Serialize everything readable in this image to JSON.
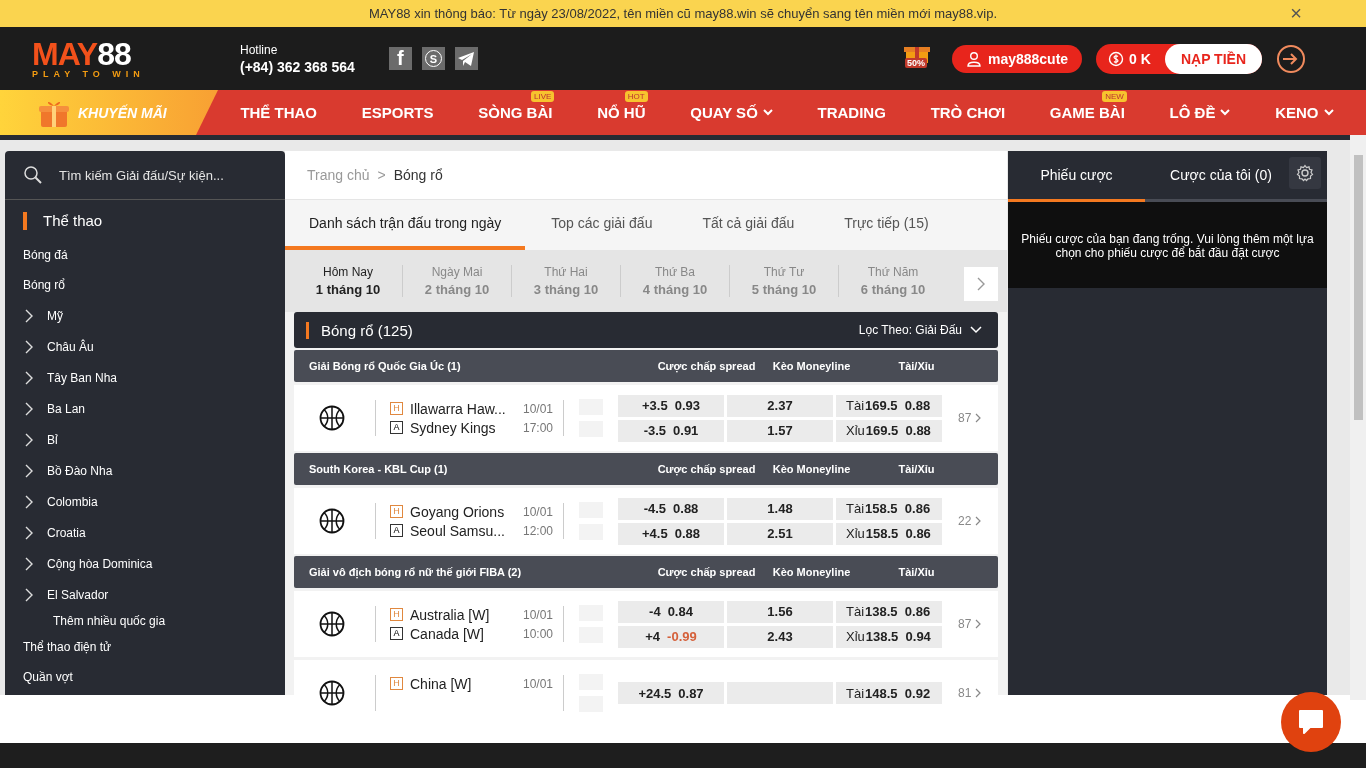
{
  "notice": {
    "text": "MAY88 xin thông báo: Từ ngày 23/08/2022, tên miền cũ may88.win sẽ chuyển sang tên miền mới may88.vip.",
    "close": "×"
  },
  "header": {
    "logo": {
      "brand_a": "MAY",
      "brand_b": "88",
      "tagline": "PLAY TO WIN"
    },
    "hotline_label": "Hotline",
    "hotline": "(+84) 362 368 564",
    "social": [
      {
        "kind": "facebook",
        "glyph": "f"
      },
      {
        "kind": "skype",
        "glyph": "S"
      },
      {
        "kind": "telegram"
      }
    ],
    "promo_badge": "50%",
    "username": "may888cute",
    "balance": "0 K",
    "deposit": "NẠP TIỀN"
  },
  "nav": {
    "promo": "KHUYẾN MÃI",
    "items": [
      {
        "label": "THỂ THAO",
        "dropdown": false
      },
      {
        "label": "ESPORTS",
        "dropdown": false
      },
      {
        "label": "SÒNG BÀI",
        "badge": "LIVE",
        "dropdown": false
      },
      {
        "label": "NỔ HŨ",
        "badge": "HOT",
        "dropdown": false
      },
      {
        "label": "QUAY SỐ",
        "dropdown": true
      },
      {
        "label": "TRADING",
        "dropdown": false
      },
      {
        "label": "TRÒ CHƠI",
        "dropdown": false
      },
      {
        "label": "GAME BÀI",
        "badge": "NEW",
        "dropdown": false
      },
      {
        "label": "LÔ ĐỀ",
        "dropdown": true
      },
      {
        "label": "KENO",
        "dropdown": true
      }
    ]
  },
  "sidebar": {
    "search": {
      "placeholder": "Tìm kiếm Giải đấu/Sự kiện..."
    },
    "title": "Thể thao",
    "items": [
      {
        "label": "Bóng đá"
      },
      {
        "label": "Bóng rổ",
        "children": [
          {
            "label": "Mỹ",
            "expanded": false
          },
          {
            "label": "Châu Âu",
            "expanded": false
          },
          {
            "label": "Tây Ban Nha",
            "expanded": false
          },
          {
            "label": "Ba Lan",
            "expanded": false
          },
          {
            "label": "Bỉ",
            "expanded": false
          },
          {
            "label": "Bồ Đào Nha",
            "expanded": false
          },
          {
            "label": "Colombia",
            "expanded": false
          },
          {
            "label": "Croatia",
            "expanded": false
          },
          {
            "label": "Cộng hòa Dominica",
            "expanded": false
          },
          {
            "label": "El Salvador",
            "expanded": false
          }
        ],
        "more": "Thêm nhiều quốc gia"
      },
      {
        "label": "Thể thao điện tử"
      },
      {
        "label": "Quần vợt"
      }
    ]
  },
  "breadcrumb": [
    {
      "label": "Trang chủ"
    },
    {
      "label": "Bóng rổ"
    }
  ],
  "breadcrumb_separator": ">",
  "tabs": [
    {
      "label": "Danh sách trận đấu trong ngày",
      "selected": true
    },
    {
      "label": "Top các giải đấu",
      "selected": false
    },
    {
      "label": "Tất cả giải đấu",
      "selected": false
    },
    {
      "label": "Trực tiếp (15)",
      "selected": false
    }
  ],
  "dates": [
    {
      "day": "Hôm Nay",
      "date": "1 tháng 10",
      "selected": true
    },
    {
      "day": "Ngày Mai",
      "date": "2 tháng 10",
      "selected": false
    },
    {
      "day": "Thứ Hai",
      "date": "3 tháng 10",
      "selected": false
    },
    {
      "day": "Thứ Ba",
      "date": "4 tháng 10",
      "selected": false
    },
    {
      "day": "Thứ Tư",
      "date": "5 tháng 10",
      "selected": false
    },
    {
      "day": "Thứ Năm",
      "date": "6 tháng 10",
      "selected": false
    }
  ],
  "sport_header": {
    "title": "Bóng rổ (125)",
    "filter": "Lọc Theo: Giải Đấu"
  },
  "leagues": [
    {
      "name": "Giải Bóng rổ Quốc Gia Úc (1)",
      "columns": [
        "Cược chấp spread",
        "Kèo Moneyline",
        "Tài/Xỉu"
      ],
      "matches": [
        {
          "home_tag": "H",
          "home": "Illawarra Haw...",
          "away_tag": "A",
          "away": "Sydney Kings",
          "date": "10/01",
          "time": "17:00",
          "more": "87",
          "spread": [
            {
              "line": "+3.5",
              "price": "0.93",
              "negative": false
            },
            {
              "line": "-3.5",
              "price": "0.91",
              "negative": false
            }
          ],
          "moneyline": [
            "2.37",
            "1.57"
          ],
          "total": [
            {
              "side": "Tài",
              "line": "169.5",
              "price": "0.88"
            },
            {
              "side": "Xỉu",
              "line": "169.5",
              "price": "0.88"
            }
          ]
        }
      ]
    },
    {
      "name": "South Korea - KBL Cup (1)",
      "columns": [
        "Cược chấp spread",
        "Kèo Moneyline",
        "Tài/Xỉu"
      ],
      "matches": [
        {
          "home_tag": "H",
          "home": "Goyang Orions",
          "away_tag": "A",
          "away": "Seoul Samsu...",
          "date": "10/01",
          "time": "12:00",
          "more": "22",
          "spread": [
            {
              "line": "-4.5",
              "price": "0.88",
              "negative": false
            },
            {
              "line": "+4.5",
              "price": "0.88",
              "negative": false
            }
          ],
          "moneyline": [
            "1.48",
            "2.51"
          ],
          "total": [
            {
              "side": "Tài",
              "line": "158.5",
              "price": "0.86"
            },
            {
              "side": "Xỉu",
              "line": "158.5",
              "price": "0.86"
            }
          ]
        }
      ]
    },
    {
      "name": "Giải vô địch bóng rổ nữ thế giới FIBA (2)",
      "columns": [
        "Cược chấp spread",
        "Kèo Moneyline",
        "Tài/Xỉu"
      ],
      "matches": [
        {
          "home_tag": "H",
          "home": "Australia [W]",
          "away_tag": "A",
          "away": "Canada [W]",
          "date": "10/01",
          "time": "10:00",
          "more": "87",
          "spread": [
            {
              "line": "-4",
              "price": "0.84",
              "negative": false
            },
            {
              "line": "+4",
              "price": "-0.99",
              "negative": true
            }
          ],
          "moneyline": [
            "1.56",
            "2.43"
          ],
          "total": [
            {
              "side": "Tài",
              "line": "138.5",
              "price": "0.86"
            },
            {
              "side": "Xỉu",
              "line": "138.5",
              "price": "0.94"
            }
          ]
        },
        {
          "home_tag": "H",
          "home": "China [W]",
          "date": "10/01",
          "more": "81",
          "spread": [
            {
              "line": "+24.5",
              "price": "0.87",
              "negative": false
            }
          ],
          "total": [
            {
              "side": "Tài",
              "line": "148.5",
              "price": "0.92"
            }
          ]
        }
      ]
    }
  ],
  "betslip": {
    "tabs": [
      {
        "label": "Phiếu cược",
        "selected": true
      },
      {
        "label": "Cược của tôi (0)",
        "selected": false
      }
    ],
    "empty": "Phiếu cược của bạn đang trống. Vui lòng thêm một lựa chọn cho phiếu cược để bắt đầu đặt cược"
  }
}
